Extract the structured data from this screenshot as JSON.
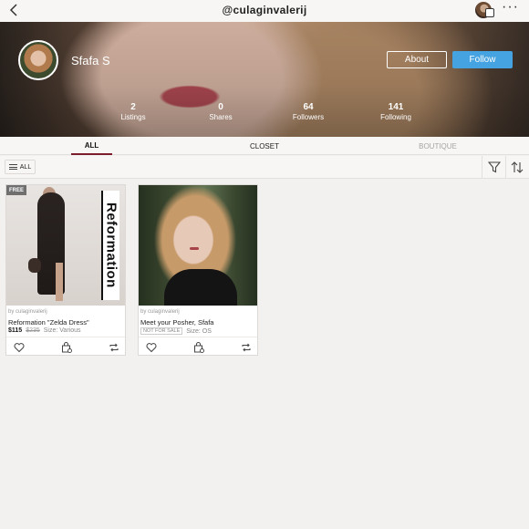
{
  "topbar": {
    "back_icon": "chevron-left-icon",
    "title": "@culaginvalerij",
    "more_label": "···"
  },
  "profile": {
    "name": "Sfafa S",
    "about_label": "About",
    "follow_label": "Follow",
    "stats": [
      {
        "value": "2",
        "label": "Listings"
      },
      {
        "value": "0",
        "label": "Shares"
      },
      {
        "value": "64",
        "label": "Followers"
      },
      {
        "value": "141",
        "label": "Following"
      }
    ],
    "colors": {
      "follow_button": "#44a3e0"
    }
  },
  "tabs": [
    {
      "label": "ALL",
      "active": true
    },
    {
      "label": "CLOSET",
      "active": false
    },
    {
      "label": "BOUTIQUE",
      "active": false
    }
  ],
  "filter": {
    "all_label": "ALL",
    "filter_icon": "funnel-icon",
    "sort_icon": "sort-icon"
  },
  "listings": [
    {
      "badge": "FREE",
      "image_text": "Reformation",
      "by": "by culaginvalerij",
      "title": "Reformation \"Zelda Dress\"",
      "price": "$115",
      "original_price": "$235",
      "size": "Size: Various"
    },
    {
      "by": "by culaginvalerij",
      "title": "Meet your Posher, Sfafa",
      "status": "NOT FOR SALE",
      "size": "Size: OS"
    }
  ]
}
